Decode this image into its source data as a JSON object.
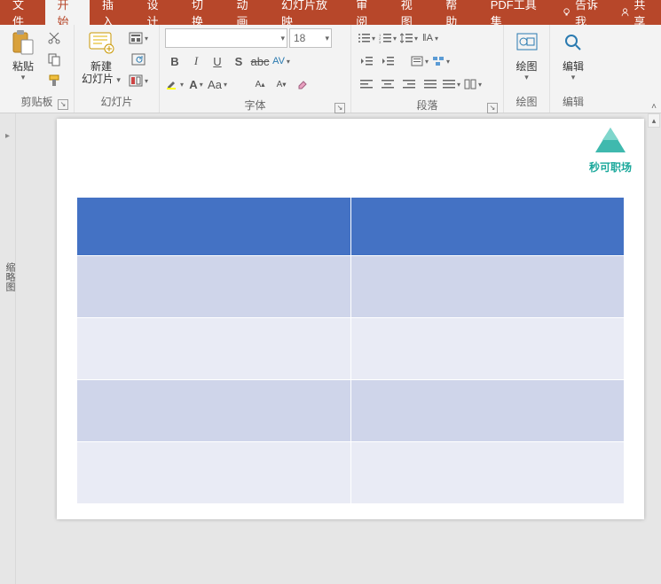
{
  "tabs": {
    "file": "文件",
    "home": "开始",
    "insert": "插入",
    "design": "设计",
    "transitions": "切换",
    "animations": "动画",
    "slideshow": "幻灯片放映",
    "review": "审阅",
    "view": "视图",
    "help": "帮助",
    "pdf": "PDF工具集",
    "tellme": "告诉我",
    "share": "共享"
  },
  "groups": {
    "clipboard": "剪贴板",
    "slides": "幻灯片",
    "font": "字体",
    "paragraph": "段落",
    "drawing": "绘图",
    "editing": "编辑"
  },
  "buttons": {
    "paste": "粘贴",
    "newslide_l1": "新建",
    "newslide_l2": "幻灯片",
    "drawing": "绘图",
    "editing": "编辑"
  },
  "font": {
    "name_placeholder": "",
    "size": "18"
  },
  "outline_label": "缩略图",
  "logo_text": "秒可职场",
  "chart_data": {
    "type": "table",
    "columns": 2,
    "rows": 5,
    "header_style": "filled",
    "cells": [
      [
        "",
        ""
      ],
      [
        "",
        ""
      ],
      [
        "",
        ""
      ],
      [
        "",
        ""
      ],
      [
        "",
        ""
      ]
    ]
  }
}
